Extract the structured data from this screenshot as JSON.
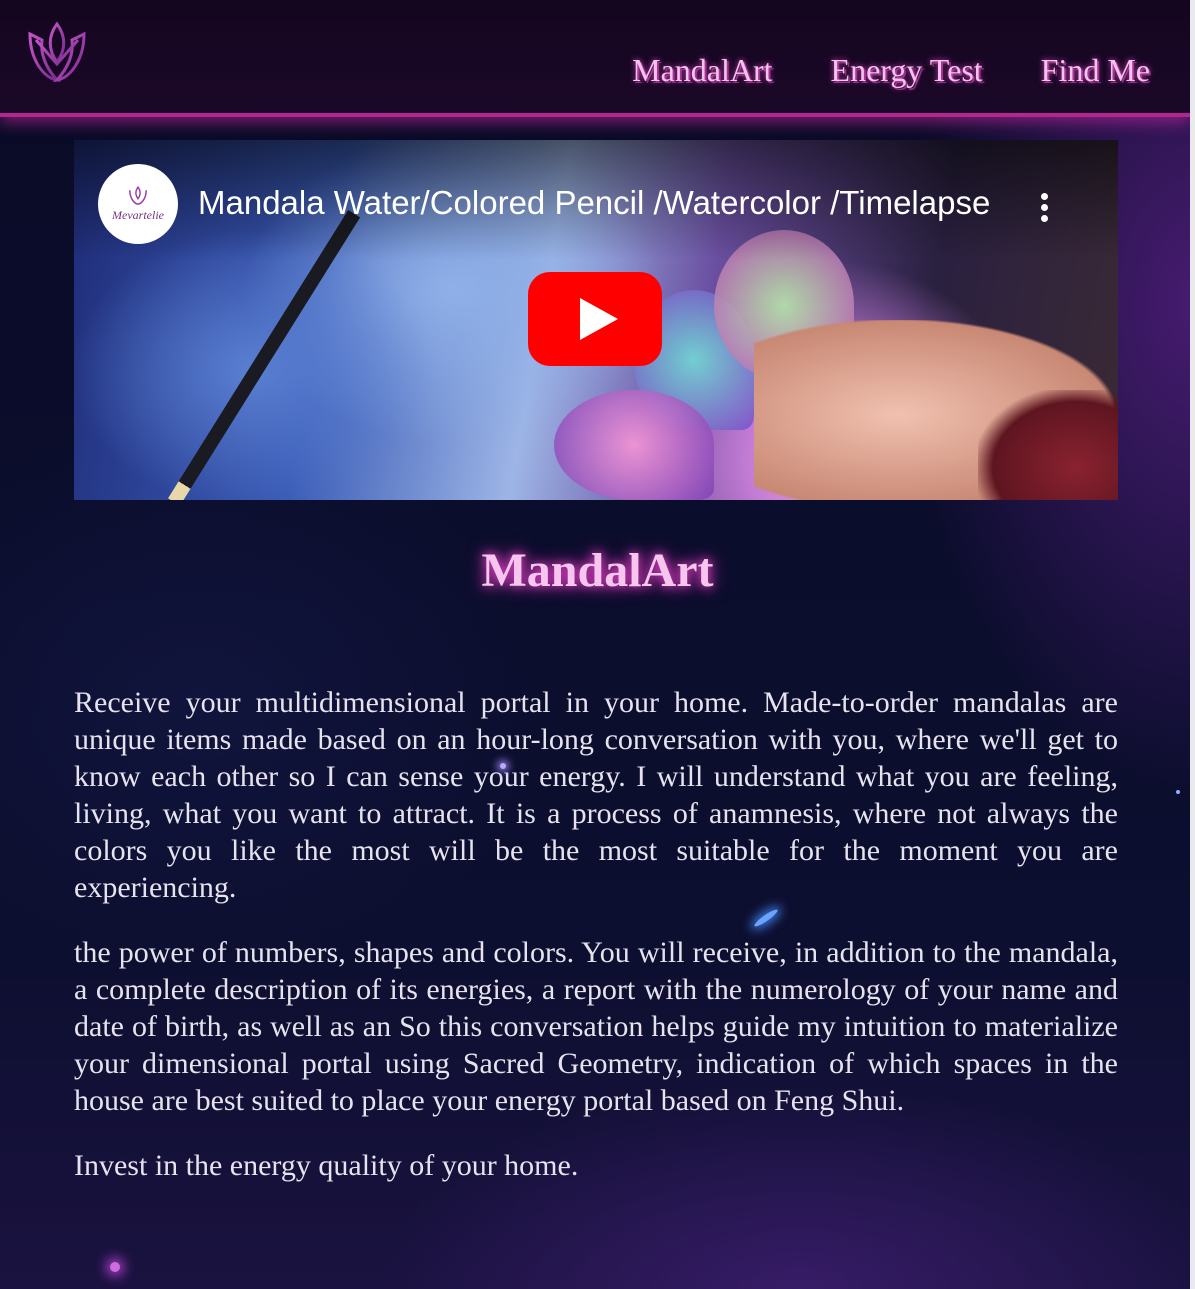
{
  "nav": {
    "items": [
      {
        "label": "MandalArt"
      },
      {
        "label": "Energy Test"
      },
      {
        "label": "Find Me"
      }
    ]
  },
  "video": {
    "title": "Mandala Water/Colored Pencil /Watercolor /Timelapse",
    "channel_name": "Mevartelie"
  },
  "main": {
    "title": "MandalArt",
    "paragraphs": [
      "Receive your multidimensional portal in your home. Made-to-order mandalas are unique items made based on an hour-long conversation with you, where we'll get to know each other so I can sense your energy. I will understand what you are feeling, living, what you want to attract. It is a process of anamnesis, where not always the colors you like the most will be the most suitable for the moment you are experiencing.",
      "the power of numbers, shapes and colors. You will receive, in addition to the mandala, a complete description of its energies, a report with the numerology of your name and date of birth, as well as an So this conversation helps guide my intuition to materialize your dimensional portal using Sacred Geometry, indication of which spaces in the house are best suited to place your energy portal based on Feng Shui.",
      "Invest in the energy quality of your home."
    ]
  },
  "colors": {
    "accent": "#b3268f",
    "title_glow": "#e844c9",
    "play_button": "#ff0000"
  },
  "icons": {
    "logo": "lotus-logo-icon",
    "play": "play-icon",
    "more": "more-vertical-icon"
  }
}
